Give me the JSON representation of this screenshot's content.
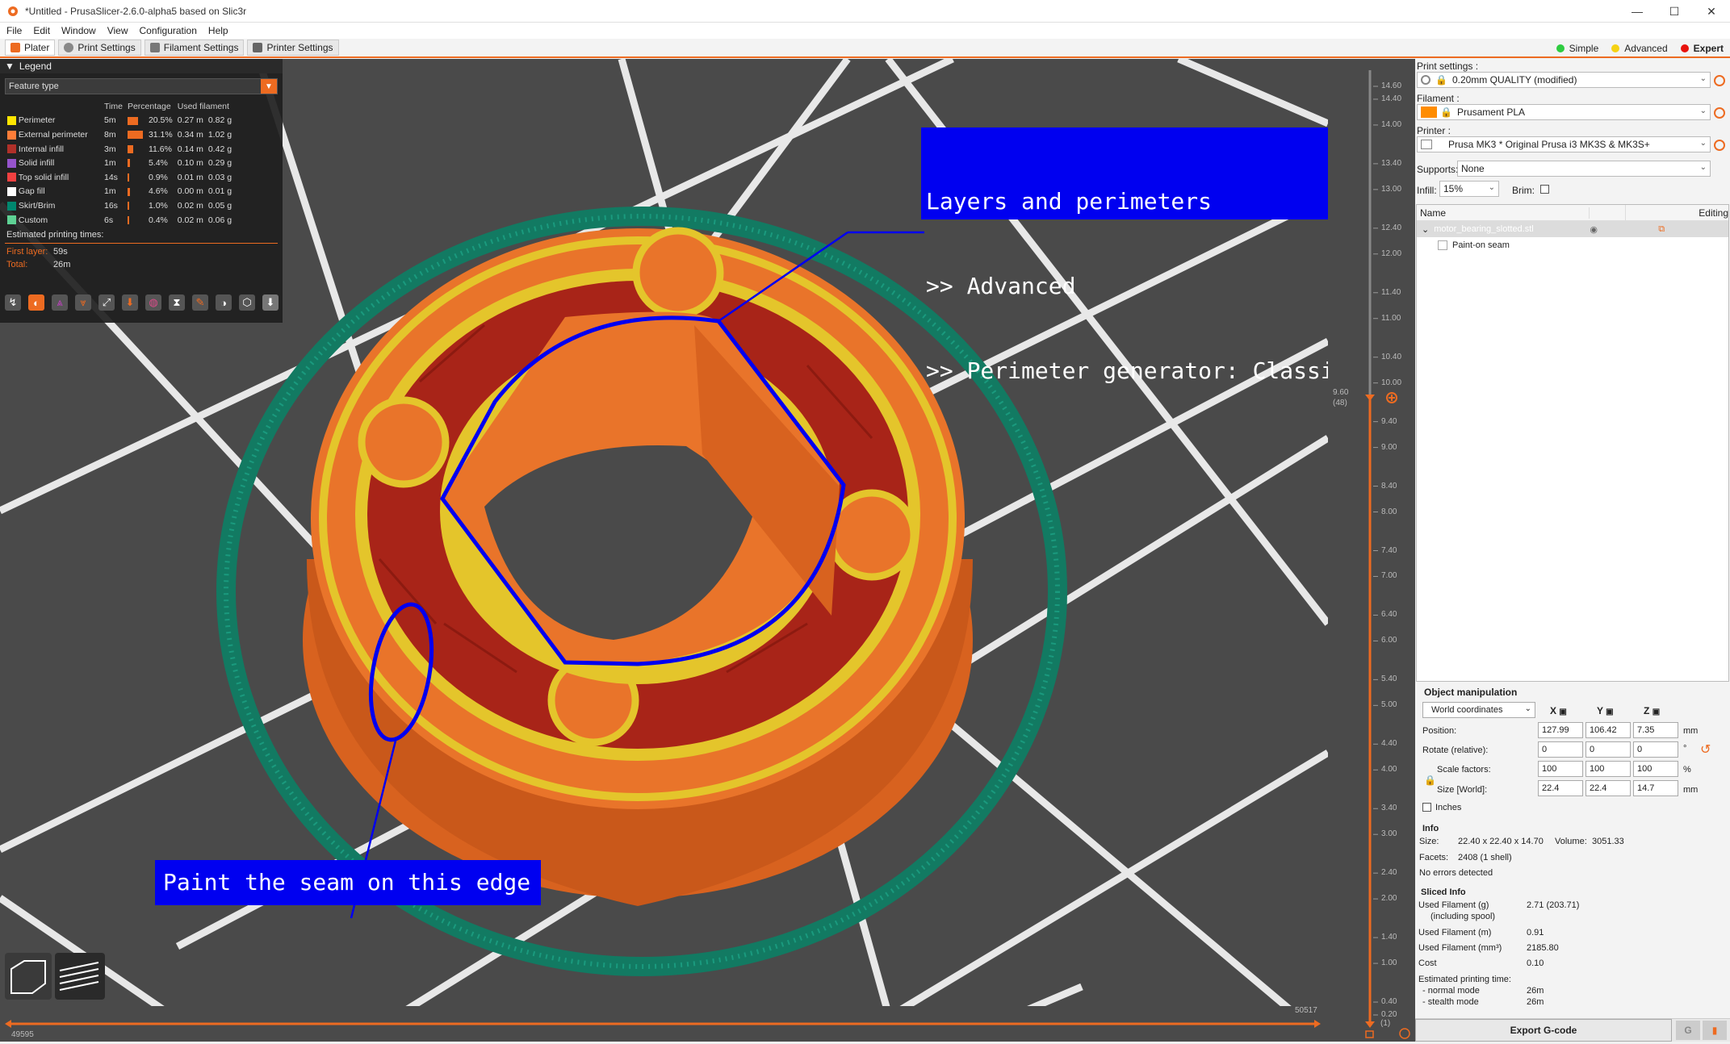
{
  "window": {
    "title": "*Untitled - PrusaSlicer-2.6.0-alpha5 based on Slic3r",
    "controls": [
      "—",
      "☐",
      "✕"
    ]
  },
  "menu": [
    "File",
    "Edit",
    "Window",
    "View",
    "Configuration",
    "Help"
  ],
  "tabs": [
    {
      "label": "Plater",
      "icon": "plater-icon"
    },
    {
      "label": "Print Settings",
      "icon": "gear-icon"
    },
    {
      "label": "Filament Settings",
      "icon": "spool-icon"
    },
    {
      "label": "Printer Settings",
      "icon": "printer-icon"
    }
  ],
  "modes": [
    {
      "label": "Simple",
      "color": "#2ecc40"
    },
    {
      "label": "Advanced",
      "color": "#f5d213"
    },
    {
      "label": "Expert",
      "color": "#e8120c"
    }
  ],
  "legend": {
    "title": "Legend",
    "view_type": "Feature type",
    "columns": [
      "Time",
      "Percentage",
      "Used filament"
    ],
    "rows": [
      {
        "name": "Perimeter",
        "color": "#ffe600",
        "time": "5m",
        "pct": "20.5%",
        "len": "0.27 m",
        "weight": "0.82 g",
        "frac": 0.205
      },
      {
        "name": "External perimeter",
        "color": "#ff7d38",
        "time": "8m",
        "pct": "31.1%",
        "len": "0.34 m",
        "weight": "1.02 g",
        "frac": 0.311
      },
      {
        "name": "Internal infill",
        "color": "#b03029",
        "time": "3m",
        "pct": "11.6%",
        "len": "0.14 m",
        "weight": "0.42 g",
        "frac": 0.116
      },
      {
        "name": "Solid infill",
        "color": "#9654cc",
        "time": "1m",
        "pct": "5.4%",
        "len": "0.10 m",
        "weight": "0.29 g",
        "frac": 0.054
      },
      {
        "name": "Top solid infill",
        "color": "#f04040",
        "time": "14s",
        "pct": "0.9%",
        "len": "0.01 m",
        "weight": "0.03 g",
        "frac": 0.009
      },
      {
        "name": "Gap fill",
        "color": "#ffffff",
        "time": "1m",
        "pct": "4.6%",
        "len": "0.00 m",
        "weight": "0.01 g",
        "frac": 0.046
      },
      {
        "name": "Skirt/Brim",
        "color": "#00876e",
        "time": "16s",
        "pct": "1.0%",
        "len": "0.02 m",
        "weight": "0.05 g",
        "frac": 0.01
      },
      {
        "name": "Custom",
        "color": "#5ed194",
        "time": "6s",
        "pct": "0.4%",
        "len": "0.02 m",
        "weight": "0.06 g",
        "frac": 0.004
      }
    ],
    "estimated_label": "Estimated printing times:",
    "first_layer_label": "First layer:",
    "first_layer_value": "59s",
    "total_label": "Total:",
    "total_value": "26m"
  },
  "annotations": {
    "top_lines": [
      "Layers and perimeters",
      ">> Advanced",
      ">> Perimeter generator: Classic"
    ],
    "bottom": "Paint the seam on this edge"
  },
  "vslider": {
    "ticks": [
      "14.60",
      "14.40",
      "14.00",
      "13.40",
      "13.00",
      "12.40",
      "12.00",
      "11.40",
      "11.00",
      "10.40",
      "10.00",
      "9.40",
      "9.00",
      "8.40",
      "8.00",
      "7.40",
      "7.00",
      "6.40",
      "6.00",
      "5.40",
      "5.00",
      "4.40",
      "4.00",
      "3.40",
      "3.00",
      "2.40",
      "2.00",
      "1.40",
      "1.00",
      "0.40",
      "0.20"
    ],
    "current": "9.60",
    "current_layer": "(48)",
    "bottom_layer": "(1)"
  },
  "hslider": {
    "left": "49595",
    "right": "50517"
  },
  "print_settings": {
    "label": "Print settings :",
    "value": "0.20mm QUALITY (modified)"
  },
  "filament": {
    "label": "Filament :",
    "value": "Prusament PLA",
    "color": "#ff8c00"
  },
  "printer": {
    "label": "Printer :",
    "value": "Prusa MK3 * Original Prusa i3 MK3S & MK3S+"
  },
  "supports": {
    "label": "Supports:",
    "value": "None"
  },
  "infill": {
    "label": "Infill:",
    "value": "15%"
  },
  "brim": {
    "label": "Brim:"
  },
  "object_list": {
    "col_name": "Name",
    "col_editing": "Editing",
    "object": "motor_bearing_slotted.stl",
    "sub_item": "Paint-on seam"
  },
  "object_manipulation": {
    "title": "Object manipulation",
    "coords": "World coordinates",
    "axes": [
      "X",
      "Y",
      "Z"
    ],
    "position_label": "Position:",
    "position": [
      "127.99",
      "106.42",
      "7.35"
    ],
    "position_unit": "mm",
    "rotate_label": "Rotate (relative):",
    "rotate": [
      "0",
      "0",
      "0"
    ],
    "rotate_unit": "°",
    "scale_label": "Scale factors:",
    "scale": [
      "100",
      "100",
      "100"
    ],
    "scale_unit": "%",
    "size_label": "Size [World]:",
    "size": [
      "22.4",
      "22.4",
      "14.7"
    ],
    "size_unit": "mm",
    "inches_label": "Inches"
  },
  "info": {
    "title": "Info",
    "size_label": "Size:",
    "size_value": "22.40 x 22.40 x 14.70",
    "volume_label": "Volume:",
    "volume_value": "3051.33",
    "facets_label": "Facets:",
    "facets_value": "2408 (1 shell)",
    "errors": "No errors detected"
  },
  "sliced_info": {
    "title": "Sliced Info",
    "rows": [
      {
        "label": "Used Filament (g)",
        "value": "2.71 (203.71)"
      },
      {
        "label": "(including spool)",
        "value": ""
      },
      {
        "label": "Used Filament (m)",
        "value": "0.91"
      },
      {
        "label": "Used Filament (mm³)",
        "value": "2185.80"
      },
      {
        "label": "Cost",
        "value": "0.10"
      },
      {
        "label": "Estimated printing time:",
        "value": ""
      },
      {
        "label": "- normal mode",
        "value": "26m"
      },
      {
        "label": "- stealth mode",
        "value": "26m"
      }
    ]
  },
  "export_label": "Export G-code"
}
